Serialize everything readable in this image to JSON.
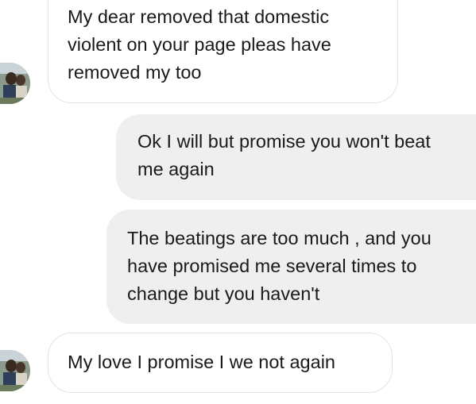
{
  "conversation": {
    "messages": [
      {
        "direction": "received",
        "text": "My dear removed that domestic\nviolent on your page pleas have\nremoved my too"
      },
      {
        "direction": "sent",
        "text": "Ok I will but promise you won't beat\nme again"
      },
      {
        "direction": "sent",
        "text": "The beatings are too much , and you\nhave promised me several times to\nchange but you haven't"
      },
      {
        "direction": "received",
        "text": "My love I promise I we not again"
      }
    ]
  },
  "colors": {
    "received_bubble_bg": "#ffffff",
    "received_bubble_border": "#e3e3e3",
    "sent_bubble_bg": "#efefef",
    "text": "#1a1a1a"
  },
  "icons": {
    "contact_avatar": "avatar"
  }
}
